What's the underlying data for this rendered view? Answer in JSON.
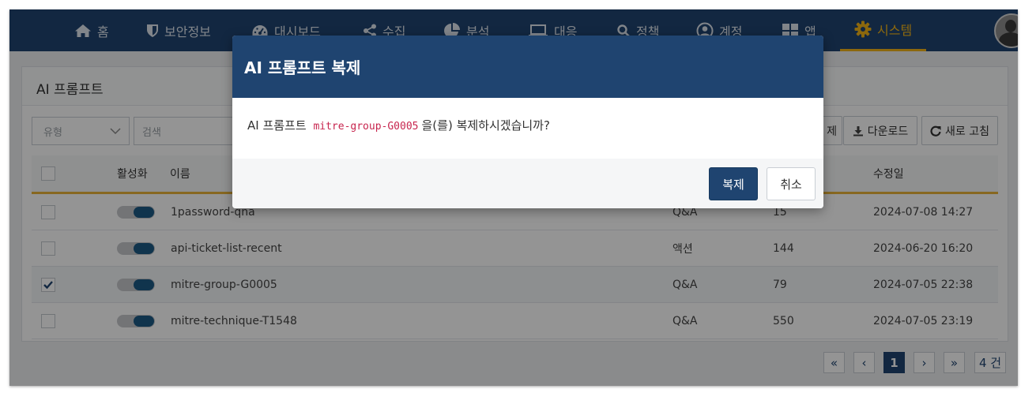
{
  "nav": {
    "items": [
      {
        "label": "홈"
      },
      {
        "label": "보안정보"
      },
      {
        "label": "대시보드"
      },
      {
        "label": "수집"
      },
      {
        "label": "분석"
      },
      {
        "label": "대응"
      },
      {
        "label": "정책"
      },
      {
        "label": "계정"
      },
      {
        "label": "앱"
      },
      {
        "label": "시스템"
      }
    ],
    "active": "시스템",
    "accent_color": "#f2b318",
    "background_color": "#1f4470"
  },
  "panel": {
    "title": "AI 프롬프트",
    "type_select": {
      "value": "유형"
    },
    "search": {
      "placeholder": "검색"
    },
    "buttons": {
      "hidden_partial": "제",
      "download": "다운로드",
      "refresh": "새로 고침"
    }
  },
  "table": {
    "columns": {
      "active": "활성화",
      "name": "이름",
      "modified": "수정일"
    },
    "rows": [
      {
        "name": "1password-qna",
        "type": "Q&A",
        "count": "15",
        "modified": "2024-07-08 14:27",
        "checked": false,
        "enabled": true
      },
      {
        "name": "api-ticket-list-recent",
        "type": "액션",
        "count": "144",
        "modified": "2024-06-20 16:20",
        "checked": false,
        "enabled": true
      },
      {
        "name": "mitre-group-G0005",
        "type": "Q&A",
        "count": "79",
        "modified": "2024-07-05 22:38",
        "checked": true,
        "enabled": true
      },
      {
        "name": "mitre-technique-T1548",
        "type": "Q&A",
        "count": "550",
        "modified": "2024-07-05 23:19",
        "checked": false,
        "enabled": true
      }
    ]
  },
  "pagination": {
    "first": "«",
    "prev": "‹",
    "current": "1",
    "next": "›",
    "last": "»",
    "total": "4 건"
  },
  "modal": {
    "title": "AI 프롬프트 복제",
    "message_prefix": "AI 프롬프트",
    "message_code": "mitre-group-G0005",
    "message_suffix": "을(를) 복제하시겠습니까?",
    "confirm_label": "복제",
    "cancel_label": "취소"
  }
}
